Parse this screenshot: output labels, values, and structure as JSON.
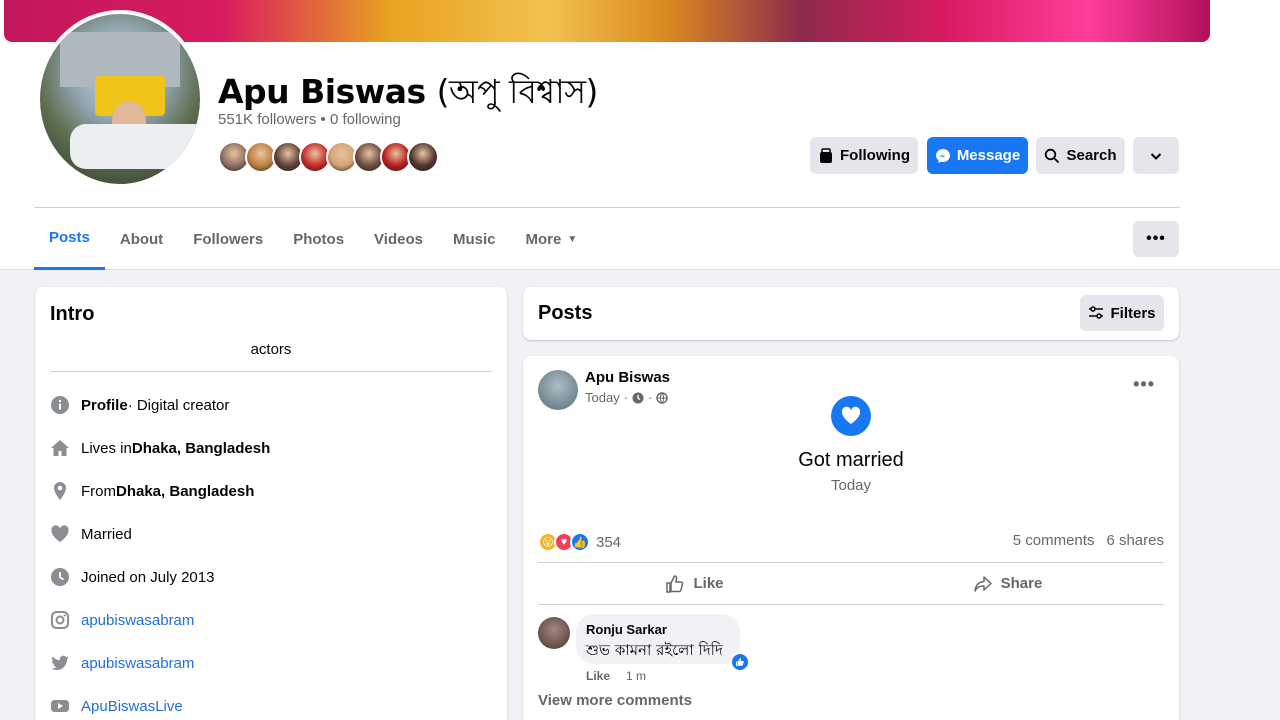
{
  "profile": {
    "name": "Apu Biswas",
    "name_alt": "(অপু বিশ্বাস)",
    "followers_text": "551K followers • 0 following"
  },
  "friend_colors": [
    "#8d6e63",
    "#bf8040",
    "#5d4037",
    "#c62828",
    "#d4a373",
    "#6d4c41",
    "#b71c1c",
    "#4e342e"
  ],
  "actions": {
    "following_label": "Following",
    "message_label": "Message",
    "search_label": "Search"
  },
  "tabs": [
    "Posts",
    "About",
    "Followers",
    "Photos",
    "Videos",
    "Music",
    "More"
  ],
  "intro": {
    "title": "Intro",
    "bio": "actors",
    "rows": [
      {
        "icon": "info-icon",
        "bold": "Profile",
        "text": " · Digital creator"
      },
      {
        "icon": "home-icon",
        "text": "Lives in ",
        "bold": "Dhaka, Bangladesh"
      },
      {
        "icon": "location-pin-icon",
        "text": "From ",
        "bold": "Dhaka, Bangladesh"
      },
      {
        "icon": "heart-icon",
        "text": "Married"
      },
      {
        "icon": "clock-icon",
        "text": "Joined on July 2013"
      },
      {
        "icon": "instagram-icon",
        "link": "apubiswasabram"
      },
      {
        "icon": "twitter-icon",
        "link": "apubiswasabram"
      },
      {
        "icon": "youtube-icon",
        "link": "ApuBiswasLive"
      }
    ]
  },
  "posts_section": {
    "title": "Posts",
    "filters_label": "Filters"
  },
  "post": {
    "author": "Apu Biswas",
    "time": "Today",
    "event_title": "Got married",
    "event_date": "Today",
    "reaction_count": "354",
    "comments": "5 comments",
    "shares": "6 shares",
    "like_label": "Like",
    "share_label": "Share",
    "comment": {
      "author": "Ronju Sarkar",
      "text": "শুভ কামনা রইলো দিদি",
      "like_label": "Like",
      "time": "1 m"
    },
    "view_more": "View more comments"
  }
}
